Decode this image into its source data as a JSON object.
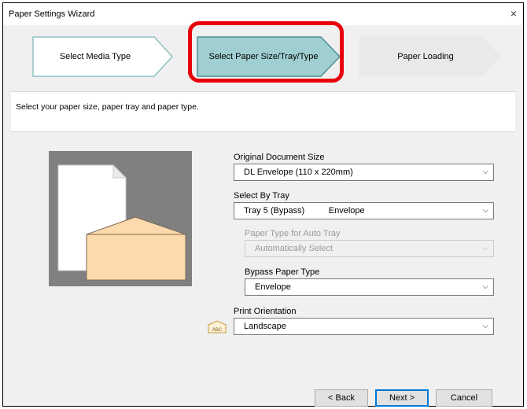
{
  "window": {
    "title": "Paper Settings Wizard",
    "close_glyph": "×"
  },
  "steps": [
    {
      "label": "Select Media Type",
      "state": "done"
    },
    {
      "label": "Select Paper Size/Tray/Type",
      "state": "active"
    },
    {
      "label": "Paper Loading",
      "state": "pending"
    }
  ],
  "instruction": "Select your paper size, paper tray and paper type.",
  "form": {
    "original_size": {
      "label": "Original Document Size",
      "value": "DL Envelope (110 x 220mm)"
    },
    "select_by_tray": {
      "label": "Select By Tray",
      "value": "Tray 5 (Bypass)          Envelope"
    },
    "paper_type_auto": {
      "label": "Paper Type for Auto Tray",
      "value": "Automatically Select",
      "enabled": false
    },
    "bypass_paper_type": {
      "label": "Bypass Paper Type",
      "value": "Envelope"
    },
    "print_orientation": {
      "label": "Print Orientation",
      "value": "Landscape",
      "icon": "abc-landscape-icon",
      "icon_text": "ABC"
    }
  },
  "buttons": {
    "back": "< Back",
    "next": "Next >",
    "cancel": "Cancel"
  },
  "colors": {
    "active_step": "#9fcfd0",
    "highlight": "#e8000b",
    "envelope": "#fdd9ae",
    "preview_bg": "#808080"
  }
}
